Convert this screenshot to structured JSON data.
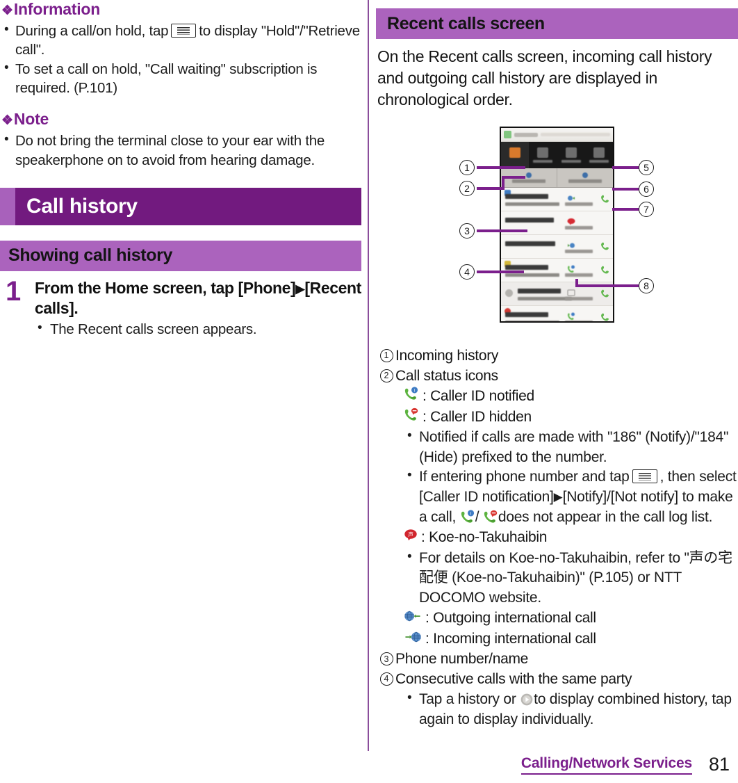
{
  "page": {
    "number": "81",
    "footer_chapter": "Calling/Network Services"
  },
  "colors": {
    "chapter_band": "#721a7f",
    "chapter_accent": "#a861bb",
    "section_band": "#ab63bd",
    "heading_purple": "#7b1f8c",
    "divider": "#8a4d9b",
    "callout_lead": "#7b1f8c"
  },
  "left_column": {
    "information": {
      "diamond": "❖",
      "heading": "Information",
      "bullets": [
        {
          "pre": "During a call/on hold, tap",
          "icon": "menu-key-icon",
          "post": "to display \"Hold\"/\"Retrieve call\"."
        },
        {
          "pre": "To set a call on hold, \"Call waiting\" subscription is required. (P.101)",
          "icon": "",
          "post": ""
        }
      ]
    },
    "note": {
      "diamond": "❖",
      "heading": "Note",
      "bullets": [
        "Do not bring the terminal close to your ear with the speakerphone on to avoid from hearing damage."
      ]
    },
    "chapter": {
      "title": "Call history"
    },
    "section": {
      "title": "Showing call history"
    },
    "step": {
      "number": "1",
      "title_a": "From the Home screen, tap [Phone]",
      "arrow": "▶",
      "title_b": "[Recent calls].",
      "bullets": [
        "The Recent calls screen appears."
      ]
    }
  },
  "right_column": {
    "section": {
      "title": "Recent calls screen"
    },
    "intro": "On the Recent calls screen, incoming call history and outgoing call history are displayed in chronological order.",
    "figure": {
      "callouts": [
        "1",
        "2",
        "3",
        "4",
        "5",
        "6",
        "7",
        "8"
      ],
      "screenshot_alt": "Recent calls screen of the Phone app"
    },
    "definitions": [
      {
        "num": "1",
        "text": "Incoming history"
      },
      {
        "num": "2",
        "text": "Call status icons"
      },
      {
        "num": "3",
        "text": "Phone number/name"
      },
      {
        "num": "4",
        "text": "Consecutive calls with the same party"
      }
    ],
    "item2_details": {
      "icon_lines": [
        {
          "icon": "caller-id-notified-icon",
          "text": ": Caller ID notified"
        },
        {
          "icon": "caller-id-hidden-icon",
          "text": ": Caller ID hidden"
        }
      ],
      "bullets": [
        "Notified if calls are made with \"186\" (Notify)/\"184\" (Hide) prefixed to the number."
      ],
      "bullet_menu": {
        "a": "If entering phone number and tap",
        "icon": "menu-key-icon",
        "b": ", then select [Caller ID notification]",
        "arrow": "▶",
        "c": "[Notify]/[Not notify] to make a call,",
        "icon2": "caller-id-notified-icon",
        "slash": "/",
        "icon3": "caller-id-hidden-icon",
        "d": "does not appear in the call log list."
      },
      "koe_icon_line": {
        "icon": "koe-no-takuhaibin-icon",
        "text": ": Koe-no-Takuhaibin"
      },
      "koe_bullet": "For details on Koe-no-Takuhaibin, refer to \"声の宅配便 (Koe-no-Takuhaibin)\" (P.105) or NTT DOCOMO website.",
      "intl_lines": [
        {
          "icon": "outgoing-international-call-icon",
          "text": ": Outgoing international call"
        },
        {
          "icon": "incoming-international-call-icon",
          "text": ": Incoming international call"
        }
      ]
    },
    "item4_details": {
      "bullet": {
        "a": "Tap a history or",
        "icon": "play-expand-icon",
        "b": "to display combined history, tap again to display individually."
      }
    }
  }
}
